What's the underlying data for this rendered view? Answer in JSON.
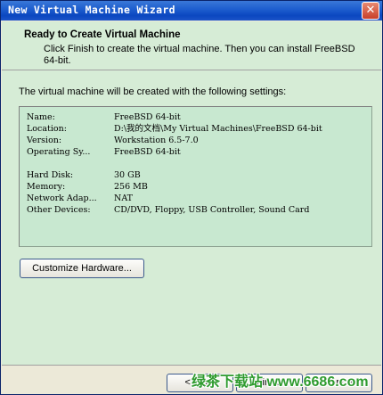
{
  "window": {
    "title": "New Virtual Machine Wizard",
    "close_glyph": "✕"
  },
  "header": {
    "title": "Ready to Create Virtual Machine",
    "subtitle": "Click Finish to create the virtual machine. Then you can install FreeBSD 64-bit."
  },
  "main": {
    "intro": "The virtual machine will be created with the following settings:",
    "settings_group1": [
      {
        "key": "Name:",
        "value": "FreeBSD 64-bit"
      },
      {
        "key": "Location:",
        "value": "D:\\我的文档\\My Virtual Machines\\FreeBSD 64-bit"
      },
      {
        "key": "Version:",
        "value": "Workstation 6.5-7.0"
      },
      {
        "key": "Operating Sy...",
        "value": "FreeBSD 64-bit"
      }
    ],
    "settings_group2": [
      {
        "key": "Hard Disk:",
        "value": "30 GB"
      },
      {
        "key": "Memory:",
        "value": "256 MB"
      },
      {
        "key": "Network Adap...",
        "value": "NAT"
      },
      {
        "key": "Other Devices:",
        "value": "CD/DVD, Floppy, USB Controller, Sound Card"
      }
    ],
    "customize_label": "Customize Hardware..."
  },
  "footer": {
    "back_label": "< Back",
    "finish_label": "Finish",
    "cancel_label": "Cancel"
  },
  "watermark": "绿茶下载站 www.6686.com",
  "colors": {
    "accent": "#0b47c0",
    "panel": "#d6ecd6",
    "settings_bg": "#c8e8d0",
    "watermark": "#2f9b2f"
  }
}
